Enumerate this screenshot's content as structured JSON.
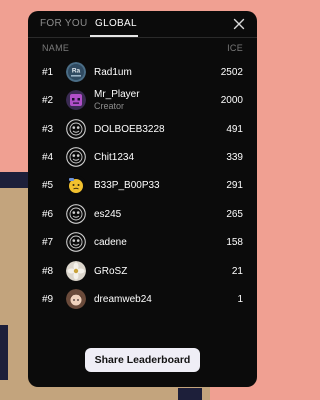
{
  "tabs": [
    {
      "label": "FOR YOU",
      "active": false
    },
    {
      "label": "GLOBAL",
      "active": true
    }
  ],
  "columns": {
    "name": "NAME",
    "score": "ICE"
  },
  "rows": [
    {
      "rank": "#1",
      "name": "Rad1um",
      "score": "2502",
      "avatar": "ra-initials-avatar"
    },
    {
      "rank": "#2",
      "name": "Mr_Player",
      "role": "Creator",
      "score": "2000",
      "avatar": "purple-robot-avatar"
    },
    {
      "rank": "#3",
      "name": "DOLBOEB3228",
      "score": "491",
      "avatar": "default-emblem-avatar"
    },
    {
      "rank": "#4",
      "name": "Chit1234",
      "score": "339",
      "avatar": "default-emblem-avatar"
    },
    {
      "rank": "#5",
      "name": "B33P_B00P33",
      "score": "291",
      "avatar": "yellow-emoji-avatar"
    },
    {
      "rank": "#6",
      "name": "es245",
      "score": "265",
      "avatar": "default-emblem-avatar"
    },
    {
      "rank": "#7",
      "name": "cadene",
      "score": "158",
      "avatar": "default-emblem-avatar"
    },
    {
      "rank": "#8",
      "name": "GRoSZ",
      "score": "21",
      "avatar": "flower-photo-avatar"
    },
    {
      "rank": "#9",
      "name": "dreamweb24",
      "score": "1",
      "avatar": "anime-girl-avatar"
    }
  ],
  "avatar_initials": "Ra",
  "share_button": "Share Leaderboard",
  "colors": {
    "panel": "#0b0b0b",
    "background": "#f0a092",
    "button": "#efeef6"
  }
}
